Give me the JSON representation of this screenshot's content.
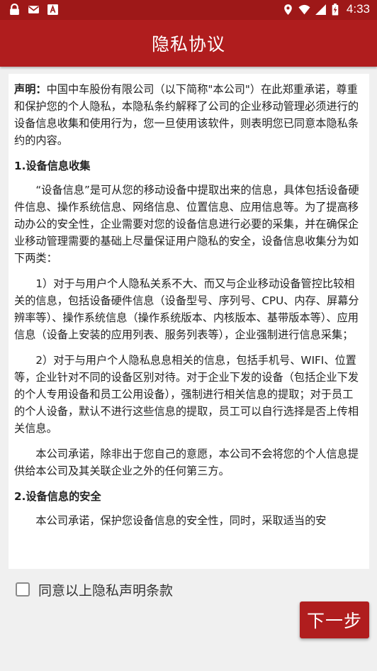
{
  "status_bar": {
    "time": "4:33",
    "left_icons": [
      "lock-icon",
      "mail-icon",
      "font-icon"
    ],
    "right_icons": [
      "location-icon",
      "wifi-icon",
      "signal-icon",
      "battery-charging-icon"
    ]
  },
  "app_bar": {
    "title": "隐私协议"
  },
  "document": {
    "statement_label": "声明：",
    "statement_text": "中国中车股份有限公司（以下简称\"本公司\"）在此郑重承诺，尊重和保护您的个人隐私，本隐私条约解释了公司的企业移动管理必须进行的设备信息收集和使用行为，您一旦使用该软件，则表明您已同意本隐私条约的内容。",
    "section1_title": "1.设备信息收集",
    "section1_p1": "“设备信息”是可从您的移动设备中提取出来的信息，具体包括设备硬件信息、操作系统信息、网络信息、位置信息、应用信息等。为了提高移动办公的安全性，企业需要对您的设备信息进行必要的采集，并在确保企业移动管理需要的基础上尽量保证用户隐私的安全，设备信息收集分为如下两类：",
    "section1_p2": "1）对于与用户个人隐私关系不大、而又与企业移动设备管控比较相关的信息，包括设备硬件信息（设备型号、序列号、CPU、内存、屏幕分辨率等）、操作系统信息（操作系统版本、内核版本、基带版本等）、应用信息（设备上安装的应用列表、服务列表等），企业强制进行信息采集；",
    "section1_p3": "2）对于与用户个人隐私息息相关的信息，包括手机号、WIFI、位置等，企业针对不同的设备区别对待。对于企业下发的设备（包括企业下发的个人专用设备和员工公用设备），强制进行相关信息的提取；对于员工的个人设备，默认不进行这些信息的提取，员工可以自行选择是否上传相关信息。",
    "section1_p4": "本公司承诺，除非出于您自己的意愿，本公司不会将您的个人信息提供给本公司及其关联企业之外的任何第三方。",
    "section2_title": "2.设备信息的安全",
    "section2_p1": "本公司承诺，保护您设备信息的安全性，同时，采取适当的安"
  },
  "agree": {
    "label": "同意以上隐私声明条款",
    "checked": false
  },
  "next_button": {
    "label": "下一步"
  },
  "colors": {
    "status_bar": "#9e1818",
    "app_bar": "#b01d1e",
    "background": "#f0f0f0",
    "button": "#b01d1e"
  }
}
